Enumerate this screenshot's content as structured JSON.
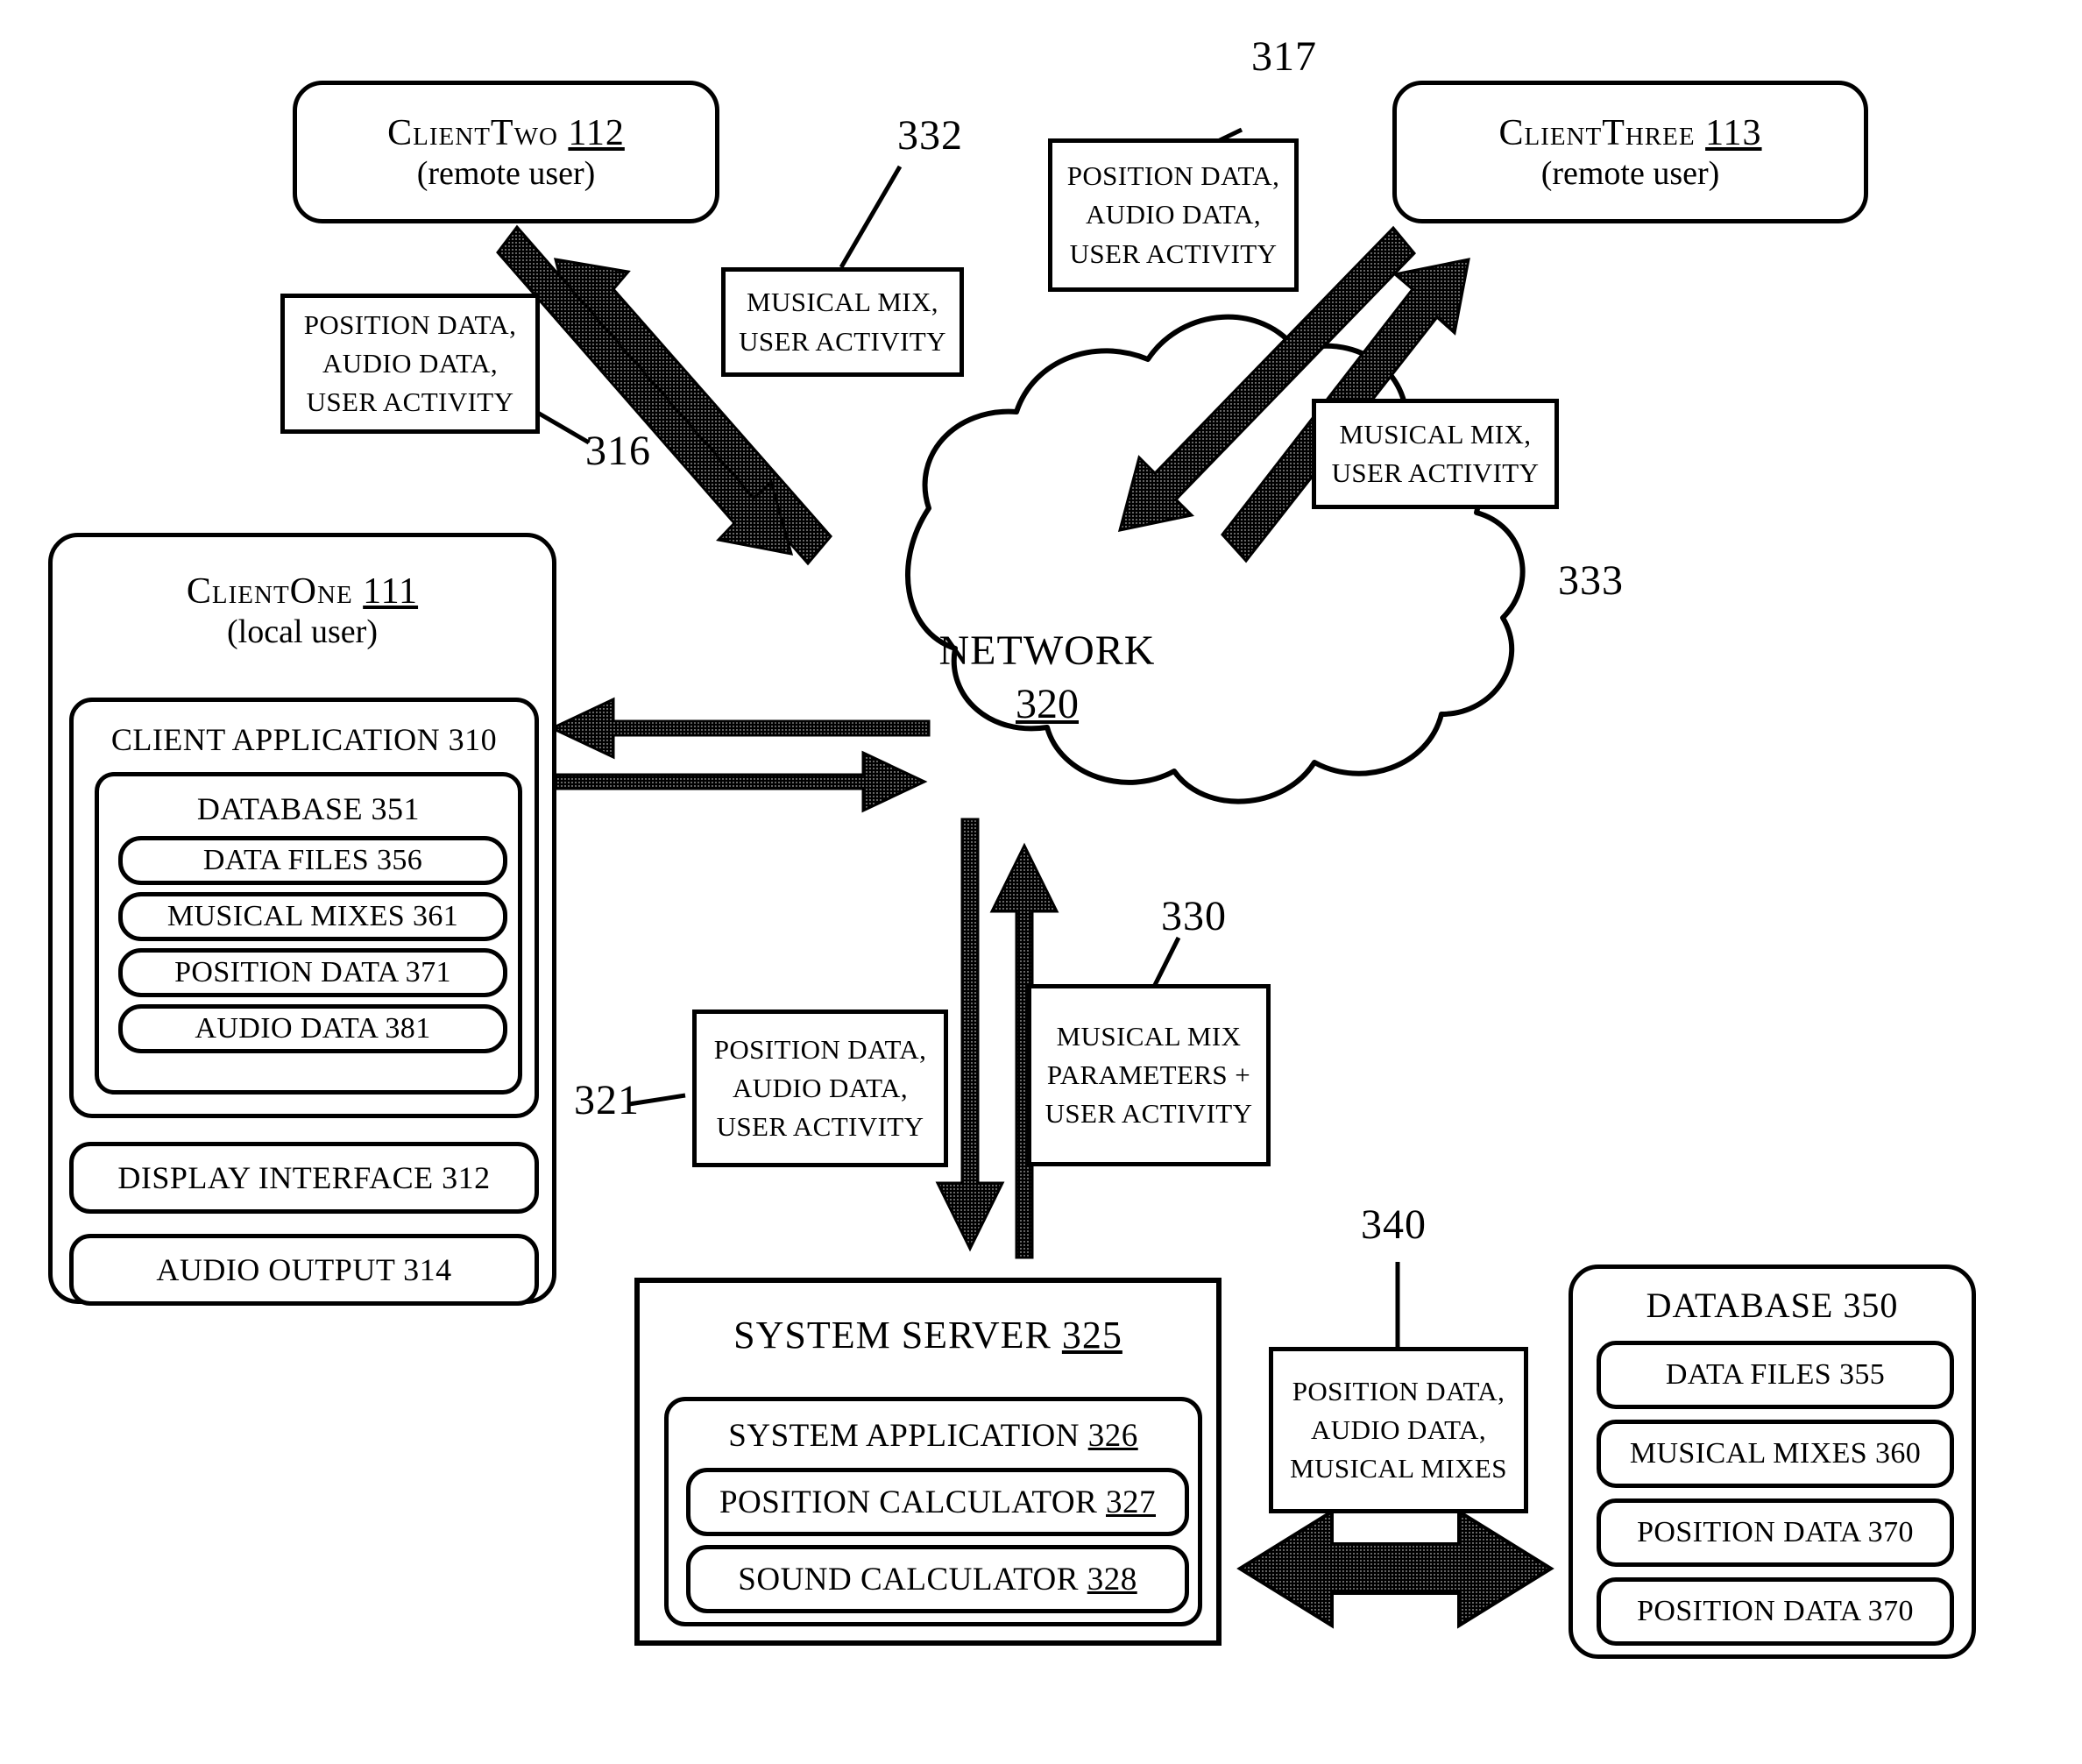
{
  "figure": {
    "nodes": {
      "client_two": {
        "title": "ClientTwo  112",
        "subtitle": "(remote user)"
      },
      "client_three": {
        "title": "ClientThree  113",
        "subtitle": "(remote user)"
      },
      "client_one": {
        "title": "ClientOne  111",
        "subtitle": "(local user)",
        "client_application": "CLIENT APPLICATION 310",
        "database": "DATABASE 351",
        "database_items": [
          "DATA FILES 356",
          "MUSICAL MIXES 361",
          "POSITION DATA 371",
          "AUDIO DATA 381"
        ],
        "display_interface": "DISPLAY INTERFACE  312",
        "audio_output": "AUDIO OUTPUT 314"
      },
      "network": {
        "title": "NETWORK",
        "number": "320"
      },
      "system_server": {
        "title": "SYSTEM SERVER  325",
        "system_application": "SYSTEM APPLICATION 326",
        "modules": [
          "POSITION CALCULATOR 327",
          "SOUND CALCULATOR 328"
        ]
      },
      "database_350": {
        "title": "DATABASE  350",
        "items": [
          "DATA FILES 355",
          "MUSICAL MIXES 360",
          "POSITION DATA 370",
          "POSITION DATA 370"
        ]
      }
    },
    "labels": {
      "l316": {
        "lines": [
          "POSITION DATA,",
          "AUDIO DATA,",
          "USER ACTIVITY"
        ],
        "ref": "316"
      },
      "l332": {
        "lines": [
          "MUSICAL MIX,",
          "USER ACTIVITY"
        ],
        "ref": "332"
      },
      "l317": {
        "lines": [
          "POSITION DATA,",
          "AUDIO DATA,",
          "USER ACTIVITY"
        ],
        "ref": "317"
      },
      "l333": {
        "lines": [
          "MUSICAL MIX,",
          "USER ACTIVITY"
        ],
        "ref": "333"
      },
      "l321": {
        "lines": [
          "POSITION DATA,",
          "AUDIO DATA,",
          "USER ACTIVITY"
        ],
        "ref": "321"
      },
      "l330": {
        "lines": [
          "MUSICAL MIX",
          "PARAMETERS +",
          "USER ACTIVITY"
        ],
        "ref": "330"
      },
      "l340": {
        "lines": [
          "POSITION DATA,",
          "AUDIO DATA,",
          "MUSICAL MIXES"
        ],
        "ref": "340"
      }
    }
  }
}
